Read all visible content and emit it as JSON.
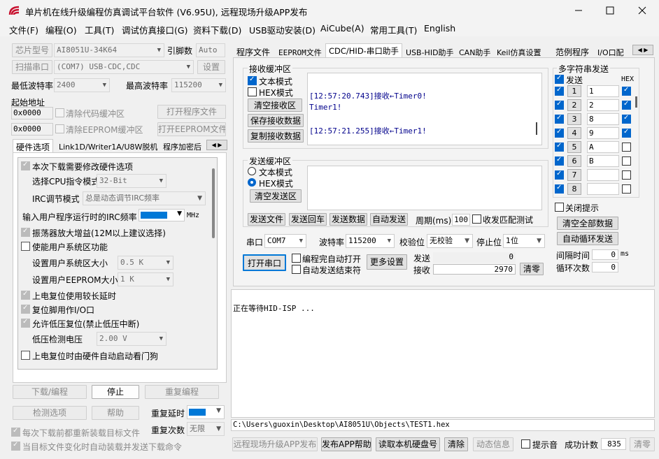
{
  "window": {
    "title": "单片机在线升级编程仿真调试平台软件 (V6.95U), 远程现场升级APP发布"
  },
  "menu": [
    "文件(F)",
    "编程(O)",
    "工具(T)",
    "调试仿真接口(G)",
    "资料下载(D)",
    "USB驱动安装(D)",
    "AiCube(A)",
    "常用工具(T)",
    "English"
  ],
  "left": {
    "chip_label": "芯片型号",
    "chip_value": "AI8051U-34K64",
    "pin_label": "引脚数",
    "pin_value": "Auto",
    "scan_btn": "扫描串口",
    "port_value": "(COM7) USB-CDC,CDC",
    "settings_btn": "设置",
    "min_baud_label": "最低波特率",
    "min_baud": "2400",
    "max_baud_label": "最高波特率",
    "max_baud": "115200",
    "start_addr_label": "起始地址",
    "addr1": "0x0000",
    "clear_code": "清除代码缓冲区",
    "open_prog": "打开程序文件",
    "addr2": "0x0000",
    "clear_eeprom": "清除EEPROM缓冲区",
    "open_eeprom": "打开EEPROM文件",
    "tabs": [
      "硬件选项",
      "Link1D/Writer1A/U8W脱机",
      "程序加密后"
    ],
    "hw": {
      "o1": "本次下载需要修改硬件选项",
      "cpu_label": "选择CPU指令模式",
      "cpu_value": "32-Bit",
      "irc_label": "IRC调节模式",
      "irc_value": "总是动态调节IRC频率",
      "freq_label": "输入用户程序运行时的IRC频率",
      "freq_unit": "MHz",
      "o2": "振荡器放大增益(12M以上建议选择)",
      "o3": "使能用户系统区功能",
      "sys_label": "设置用户系统区大小",
      "sys_value": "0.5 K",
      "ee_label": "设置用户EEPROM大小",
      "ee_value": "1   K",
      "o4": "上电复位使用较长延时",
      "o5": "复位脚用作I/O口",
      "o6": "允许低压复位(禁止低压中断)",
      "lv_label": "低压检测电压",
      "lv_value": "2.00 V",
      "o7": "上电复位时由硬件自动启动看门狗"
    },
    "download_btn": "下载/编程",
    "stop_btn": "停止",
    "reprog_btn": "重复编程",
    "check_btn": "检测选项",
    "help_btn": "帮助",
    "delay_label": "重复延时",
    "repeat_label": "重复次数",
    "repeat_value": "无限",
    "reload1": "每次下载前都重新装载目标文件",
    "reload2": "当目标文件变化时自动装载并发送下载命令"
  },
  "right": {
    "tabs": [
      "程序文件",
      "EEPROM文件",
      "CDC/HID-串口助手",
      "USB-HID助手",
      "CAN助手",
      "Keil仿真设置",
      "范例程序",
      "I/O口配"
    ],
    "recv": {
      "title": "接收缓冲区",
      "text_mode": "文本模式",
      "hex_mode": "HEX模式",
      "clear": "清空接收区",
      "save": "保存接收数据",
      "copy": "复制接收数据",
      "lines": [
        "[12:57:20.743]接收←Timer0!",
        "Timer1!",
        "",
        "[12:57:21.255]接收←Timer1!"
      ]
    },
    "send": {
      "title": "发送缓冲区",
      "text_mode": "文本模式",
      "hex_mode": "HEX模式",
      "clear": "清空发送区"
    },
    "btns": [
      "发送文件",
      "发送回车",
      "发送数据",
      "自动发送"
    ],
    "period_label": "周期(ms)",
    "period": "100",
    "match_label": "收发匹配测试",
    "port_label": "串口",
    "port": "COM7",
    "baud_label": "波特率",
    "baud": "115200",
    "parity_label": "校验位",
    "parity": "无校验",
    "stop_label": "停止位",
    "stop": "1位",
    "open_port": "打开串口",
    "auto_open": "编程完自动打开",
    "auto_send_end": "自动发送结束符",
    "more": "更多设置",
    "tx_label": "发送",
    "tx": "0",
    "rx_label": "接收",
    "rx": "2970",
    "clear_count": "清零",
    "multi": {
      "title": "多字符串发送",
      "send_col": "发送",
      "hex_col": "HEX",
      "rows": [
        {
          "n": "1",
          "v": "1"
        },
        {
          "n": "2",
          "v": "2"
        },
        {
          "n": "3",
          "v": "8"
        },
        {
          "n": "4",
          "v": "9"
        },
        {
          "n": "5",
          "v": "A"
        },
        {
          "n": "6",
          "v": "B"
        },
        {
          "n": "7",
          "v": ""
        },
        {
          "n": "8",
          "v": ""
        }
      ],
      "close_hint": "关闭提示",
      "clear_all": "清空全部数据",
      "auto_loop": "自动循环发送",
      "interval_label": "间隔时间",
      "interval": "0",
      "interval_unit": "ms",
      "loop_label": "循环次数",
      "loop": "0"
    },
    "output": "正在等待HID-ISP ...",
    "path": "C:\\Users\\guoxin\\Desktop\\AI8051U\\Objects\\TEST1.hex",
    "bottom": {
      "remote": "远程现场升级APP发布",
      "publish_help": "发布APP帮助",
      "read_hdd": "读取本机硬盘号",
      "clear": "清除",
      "anim": "动态信息",
      "beep": "提示音",
      "success_label": "成功计数",
      "success": "835",
      "zero": "清零"
    }
  }
}
